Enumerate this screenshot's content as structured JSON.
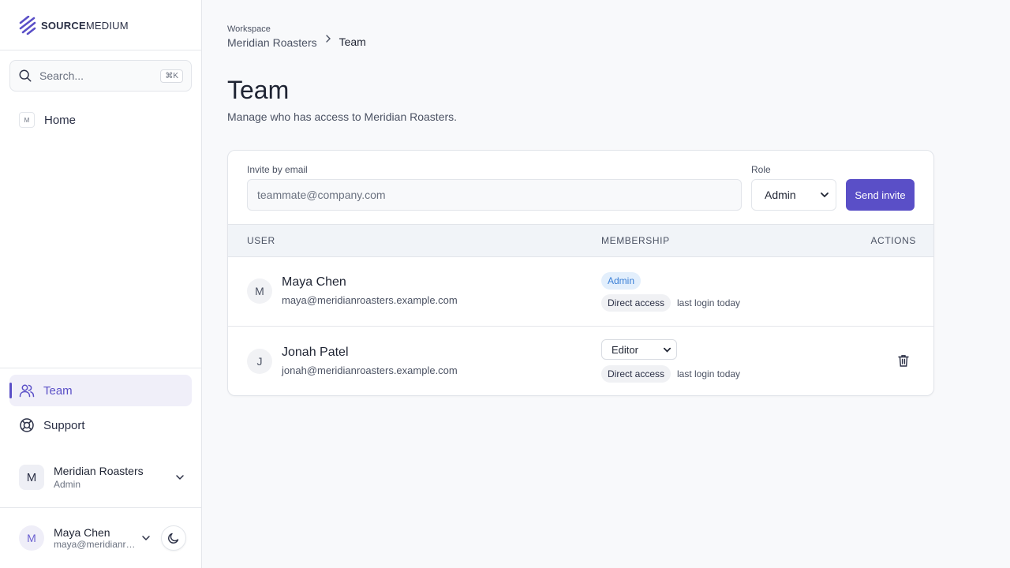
{
  "sidebar": {
    "logo": {
      "bold": "SOURCE",
      "rest": "MEDIUM"
    },
    "search": {
      "placeholder": "Search...",
      "shortcut": "⌘K"
    },
    "home": {
      "badge": "M",
      "label": "Home"
    },
    "nav": [
      {
        "label": "Team",
        "icon": "users-icon",
        "active": true
      },
      {
        "label": "Support",
        "icon": "lifebuoy-icon",
        "active": false
      }
    ],
    "org": {
      "initial": "M",
      "name": "Meridian Roasters",
      "role": "Admin"
    },
    "user": {
      "initial": "M",
      "name": "Maya Chen",
      "email": "maya@meridianroasters.example.com"
    }
  },
  "breadcrumb": {
    "workspace_label": "Workspace",
    "workspace": "Meridian Roasters",
    "current": "Team"
  },
  "page": {
    "title": "Team",
    "subtitle": "Manage who has access to Meridian Roasters."
  },
  "invite": {
    "email_label": "Invite by email",
    "email_placeholder": "teammate@company.com",
    "role_label": "Role",
    "role_value": "Admin",
    "send_label": "Send invite"
  },
  "table": {
    "headers": {
      "user": "USER",
      "membership": "MEMBERSHIP",
      "actions": "ACTIONS"
    },
    "rows": [
      {
        "initial": "M",
        "name": "Maya Chen",
        "email": "maya@meridianroasters.example.com",
        "role": "Admin",
        "access": "Direct access",
        "last_login": "last login today"
      },
      {
        "initial": "J",
        "name": "Jonah Patel",
        "email": "jonah@meridianroasters.example.com",
        "role": "Editor",
        "access": "Direct access",
        "last_login": "last login today"
      }
    ]
  },
  "colors": {
    "accent": "#5a4fc7",
    "admin_badge_bg": "#e3effc",
    "admin_badge_text": "#3a7fd6"
  }
}
